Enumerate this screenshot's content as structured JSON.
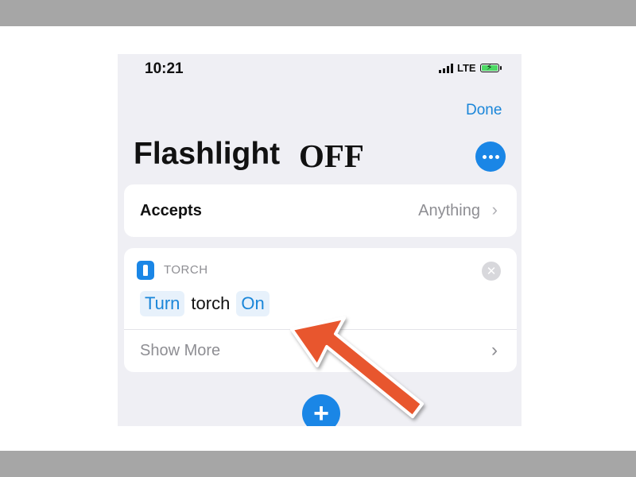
{
  "status_bar": {
    "time": "10:21",
    "network": "LTE"
  },
  "nav": {
    "done_label": "Done"
  },
  "shortcut": {
    "title": "Flashlight",
    "title_overlay": "OFF",
    "more_icon": "ellipsis-icon"
  },
  "accepts": {
    "label": "Accepts",
    "value": "Anything"
  },
  "action": {
    "header": "TORCH",
    "icon": "flashlight-icon",
    "verb": "Turn",
    "object": "torch",
    "state": "On",
    "show_more": "Show More"
  },
  "colors": {
    "accent": "#1a86e6",
    "arrow": "#e8562e",
    "battery": "#4cd964"
  }
}
